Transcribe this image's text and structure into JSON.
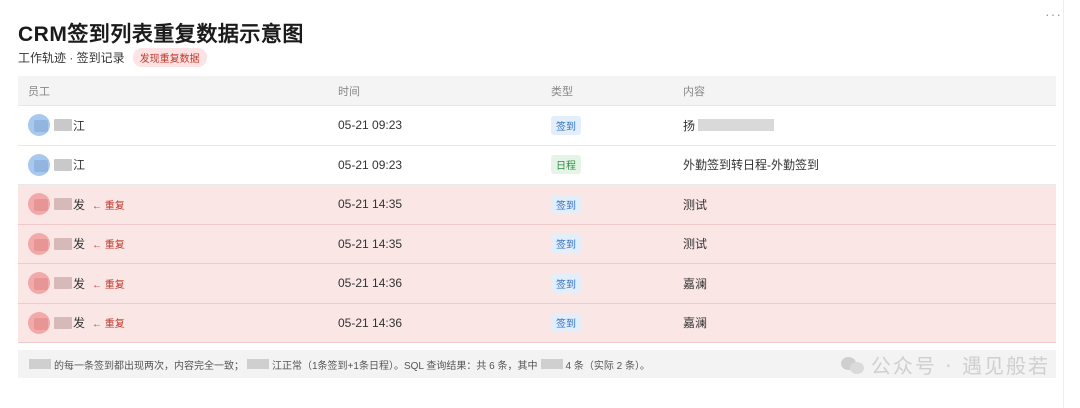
{
  "page": {
    "title": "CRM签到列表重复数据示意图",
    "subtitle": "工作轨迹 · 签到记录",
    "dup_pill": "发现重复数据",
    "more_label": "···"
  },
  "table": {
    "headers": [
      "员工",
      "时间",
      "类型",
      "内容"
    ],
    "rows": [
      {
        "name": "江",
        "dup": false,
        "dup_label": "",
        "time": "05-21 09:23",
        "type": "签到",
        "type_color": "blue",
        "content": "扬"
      },
      {
        "name": "江",
        "dup": false,
        "dup_label": "",
        "time": "05-21 09:23",
        "type": "日程",
        "type_color": "green",
        "content": "外勤签到转日程-外勤签到"
      },
      {
        "name": "发",
        "dup": true,
        "dup_label": "← 重复",
        "time": "05-21 14:35",
        "type": "签到",
        "type_color": "blue",
        "content": "测试"
      },
      {
        "name": "发",
        "dup": true,
        "dup_label": "← 重复",
        "time": "05-21 14:35",
        "type": "签到",
        "type_color": "blue",
        "content": "测试"
      },
      {
        "name": "发",
        "dup": true,
        "dup_label": "← 重复",
        "time": "05-21 14:36",
        "type": "签到",
        "type_color": "blue",
        "content": "嘉澜"
      },
      {
        "name": "发",
        "dup": true,
        "dup_label": "← 重复",
        "time": "05-21 14:36",
        "type": "签到",
        "type_color": "blue",
        "content": "嘉澜"
      }
    ]
  },
  "footer": {
    "part1": "的每一条签到都出现两次，内容完全一致；",
    "part2": "江正常（1条签到+1条日程）。SQL 查询结果：共 6 条，其中",
    "part3": "4 条（实际 2 条）。"
  },
  "watermark": {
    "text": "公众号 · 遇见般若",
    "icon": "wechat-icon"
  },
  "colors": {
    "dup_row_bg": "#fbe6e6",
    "dup_text": "#c0392b",
    "badge_blue": "#2d6fc0",
    "badge_green": "#2e8a43"
  }
}
